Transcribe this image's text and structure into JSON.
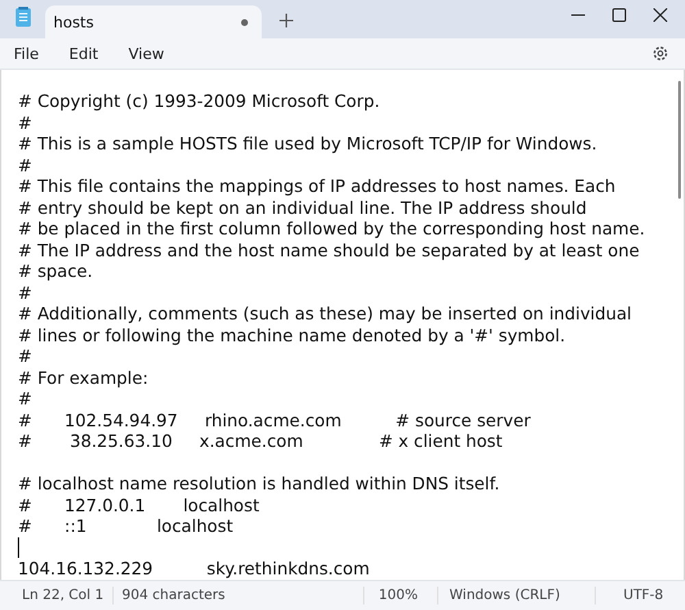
{
  "tab": {
    "title": "hosts",
    "unsaved": true
  },
  "menu": [
    "File",
    "Edit",
    "View"
  ],
  "lines": [
    {
      "kind": "text",
      "text": "# Copyright (c) 1993-2009 Microsoft Corp."
    },
    {
      "kind": "text",
      "text": "#"
    },
    {
      "kind": "text",
      "text": "# This is a sample HOSTS file used by Microsoft TCP/IP for Windows."
    },
    {
      "kind": "text",
      "text": "#"
    },
    {
      "kind": "text",
      "text": "# This file contains the mappings of IP addresses to host names. Each"
    },
    {
      "kind": "text",
      "text": "# entry should be kept on an individual line. The IP address should"
    },
    {
      "kind": "text",
      "text": "# be placed in the first column followed by the corresponding host name."
    },
    {
      "kind": "text",
      "text": "# The IP address and the host name should be separated by at least one"
    },
    {
      "kind": "text",
      "text": "# space."
    },
    {
      "kind": "text",
      "text": "#"
    },
    {
      "kind": "text",
      "text": "# Additionally, comments (such as these) may be inserted on individual"
    },
    {
      "kind": "text",
      "text": "# lines or following the machine name denoted by a '#' symbol."
    },
    {
      "kind": "text",
      "text": "#"
    },
    {
      "kind": "text",
      "text": "# For example:"
    },
    {
      "kind": "text",
      "text": "#"
    },
    {
      "kind": "text",
      "text": "#      102.54.94.97     rhino.acme.com          # source server"
    },
    {
      "kind": "text",
      "text": "#       38.25.63.10     x.acme.com              # x client host"
    },
    {
      "kind": "blank"
    },
    {
      "kind": "text",
      "text": "# localhost name resolution is handled within DNS itself."
    },
    {
      "kind": "text",
      "text": "#      127.0.0.1       localhost"
    },
    {
      "kind": "text",
      "text": "#      ::1             localhost"
    },
    {
      "kind": "caret"
    },
    {
      "kind": "text",
      "text": "104.16.132.229          sky.rethinkdns.com"
    }
  ],
  "status_bar": {
    "position": "Ln 22, Col 1",
    "characters": "904 characters",
    "zoom": "100%",
    "line_endings": "Windows (CRLF)",
    "encoding": "UTF-8"
  }
}
